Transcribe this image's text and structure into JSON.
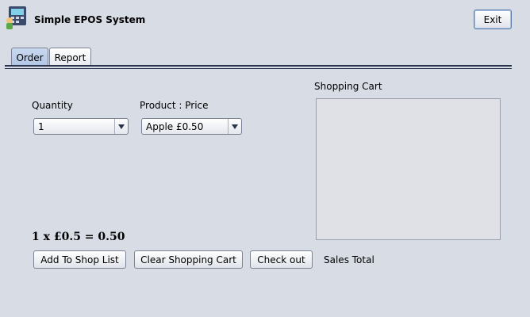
{
  "window": {
    "title": "Simple EPOS System",
    "icon": "cash-register-icon"
  },
  "toolbar": {
    "exit_label": "Exit"
  },
  "tabs": [
    {
      "label": "Order",
      "selected": true
    },
    {
      "label": "Report",
      "selected": false
    }
  ],
  "order": {
    "quantity_label": "Quantity",
    "quantity_value": "1",
    "product_label": "Product : Price",
    "product_value": "Apple £0.50",
    "calculation": "1 x £0.5 = 0.50",
    "cart_label": "Shopping Cart",
    "buttons": {
      "add": "Add To Shop List",
      "clear": "Clear Shopping Cart",
      "checkout": "Check out"
    },
    "sales_total_label": "Sales Total"
  },
  "colors": {
    "background": "#d8dce5",
    "selected_tab": "#b2c6e4",
    "accent_line": "#2b3550"
  }
}
